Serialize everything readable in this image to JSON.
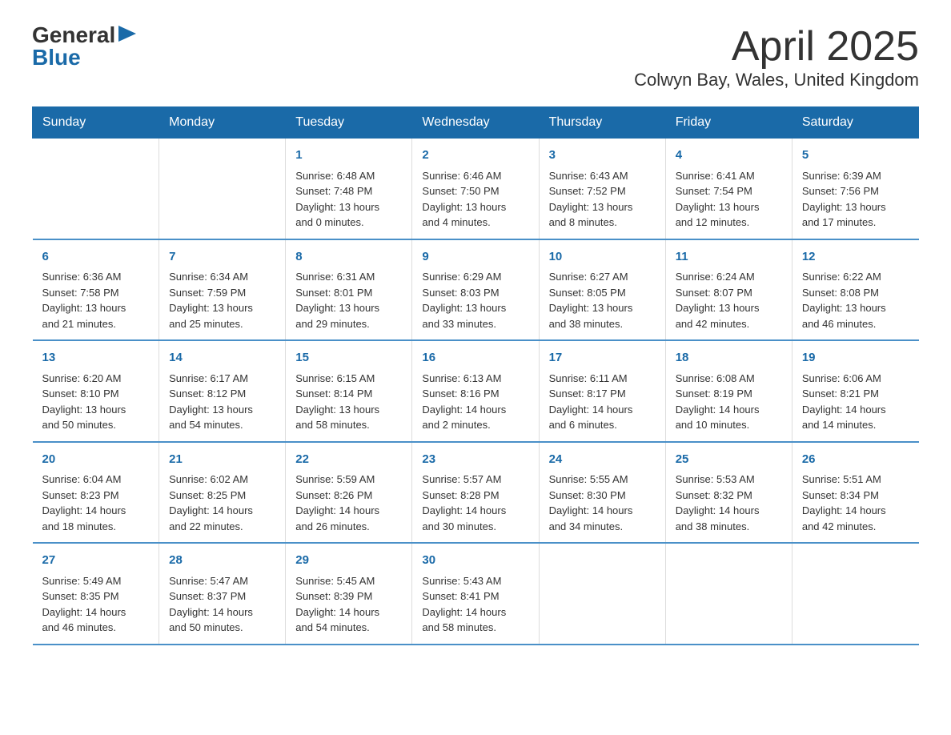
{
  "logo": {
    "general": "General",
    "blue": "Blue"
  },
  "header": {
    "month_year": "April 2025",
    "location": "Colwyn Bay, Wales, United Kingdom"
  },
  "days_of_week": [
    "Sunday",
    "Monday",
    "Tuesday",
    "Wednesday",
    "Thursday",
    "Friday",
    "Saturday"
  ],
  "weeks": [
    [
      {
        "day": "",
        "info": ""
      },
      {
        "day": "",
        "info": ""
      },
      {
        "day": "1",
        "info": "Sunrise: 6:48 AM\nSunset: 7:48 PM\nDaylight: 13 hours\nand 0 minutes."
      },
      {
        "day": "2",
        "info": "Sunrise: 6:46 AM\nSunset: 7:50 PM\nDaylight: 13 hours\nand 4 minutes."
      },
      {
        "day": "3",
        "info": "Sunrise: 6:43 AM\nSunset: 7:52 PM\nDaylight: 13 hours\nand 8 minutes."
      },
      {
        "day": "4",
        "info": "Sunrise: 6:41 AM\nSunset: 7:54 PM\nDaylight: 13 hours\nand 12 minutes."
      },
      {
        "day": "5",
        "info": "Sunrise: 6:39 AM\nSunset: 7:56 PM\nDaylight: 13 hours\nand 17 minutes."
      }
    ],
    [
      {
        "day": "6",
        "info": "Sunrise: 6:36 AM\nSunset: 7:58 PM\nDaylight: 13 hours\nand 21 minutes."
      },
      {
        "day": "7",
        "info": "Sunrise: 6:34 AM\nSunset: 7:59 PM\nDaylight: 13 hours\nand 25 minutes."
      },
      {
        "day": "8",
        "info": "Sunrise: 6:31 AM\nSunset: 8:01 PM\nDaylight: 13 hours\nand 29 minutes."
      },
      {
        "day": "9",
        "info": "Sunrise: 6:29 AM\nSunset: 8:03 PM\nDaylight: 13 hours\nand 33 minutes."
      },
      {
        "day": "10",
        "info": "Sunrise: 6:27 AM\nSunset: 8:05 PM\nDaylight: 13 hours\nand 38 minutes."
      },
      {
        "day": "11",
        "info": "Sunrise: 6:24 AM\nSunset: 8:07 PM\nDaylight: 13 hours\nand 42 minutes."
      },
      {
        "day": "12",
        "info": "Sunrise: 6:22 AM\nSunset: 8:08 PM\nDaylight: 13 hours\nand 46 minutes."
      }
    ],
    [
      {
        "day": "13",
        "info": "Sunrise: 6:20 AM\nSunset: 8:10 PM\nDaylight: 13 hours\nand 50 minutes."
      },
      {
        "day": "14",
        "info": "Sunrise: 6:17 AM\nSunset: 8:12 PM\nDaylight: 13 hours\nand 54 minutes."
      },
      {
        "day": "15",
        "info": "Sunrise: 6:15 AM\nSunset: 8:14 PM\nDaylight: 13 hours\nand 58 minutes."
      },
      {
        "day": "16",
        "info": "Sunrise: 6:13 AM\nSunset: 8:16 PM\nDaylight: 14 hours\nand 2 minutes."
      },
      {
        "day": "17",
        "info": "Sunrise: 6:11 AM\nSunset: 8:17 PM\nDaylight: 14 hours\nand 6 minutes."
      },
      {
        "day": "18",
        "info": "Sunrise: 6:08 AM\nSunset: 8:19 PM\nDaylight: 14 hours\nand 10 minutes."
      },
      {
        "day": "19",
        "info": "Sunrise: 6:06 AM\nSunset: 8:21 PM\nDaylight: 14 hours\nand 14 minutes."
      }
    ],
    [
      {
        "day": "20",
        "info": "Sunrise: 6:04 AM\nSunset: 8:23 PM\nDaylight: 14 hours\nand 18 minutes."
      },
      {
        "day": "21",
        "info": "Sunrise: 6:02 AM\nSunset: 8:25 PM\nDaylight: 14 hours\nand 22 minutes."
      },
      {
        "day": "22",
        "info": "Sunrise: 5:59 AM\nSunset: 8:26 PM\nDaylight: 14 hours\nand 26 minutes."
      },
      {
        "day": "23",
        "info": "Sunrise: 5:57 AM\nSunset: 8:28 PM\nDaylight: 14 hours\nand 30 minutes."
      },
      {
        "day": "24",
        "info": "Sunrise: 5:55 AM\nSunset: 8:30 PM\nDaylight: 14 hours\nand 34 minutes."
      },
      {
        "day": "25",
        "info": "Sunrise: 5:53 AM\nSunset: 8:32 PM\nDaylight: 14 hours\nand 38 minutes."
      },
      {
        "day": "26",
        "info": "Sunrise: 5:51 AM\nSunset: 8:34 PM\nDaylight: 14 hours\nand 42 minutes."
      }
    ],
    [
      {
        "day": "27",
        "info": "Sunrise: 5:49 AM\nSunset: 8:35 PM\nDaylight: 14 hours\nand 46 minutes."
      },
      {
        "day": "28",
        "info": "Sunrise: 5:47 AM\nSunset: 8:37 PM\nDaylight: 14 hours\nand 50 minutes."
      },
      {
        "day": "29",
        "info": "Sunrise: 5:45 AM\nSunset: 8:39 PM\nDaylight: 14 hours\nand 54 minutes."
      },
      {
        "day": "30",
        "info": "Sunrise: 5:43 AM\nSunset: 8:41 PM\nDaylight: 14 hours\nand 58 minutes."
      },
      {
        "day": "",
        "info": ""
      },
      {
        "day": "",
        "info": ""
      },
      {
        "day": "",
        "info": ""
      }
    ]
  ]
}
